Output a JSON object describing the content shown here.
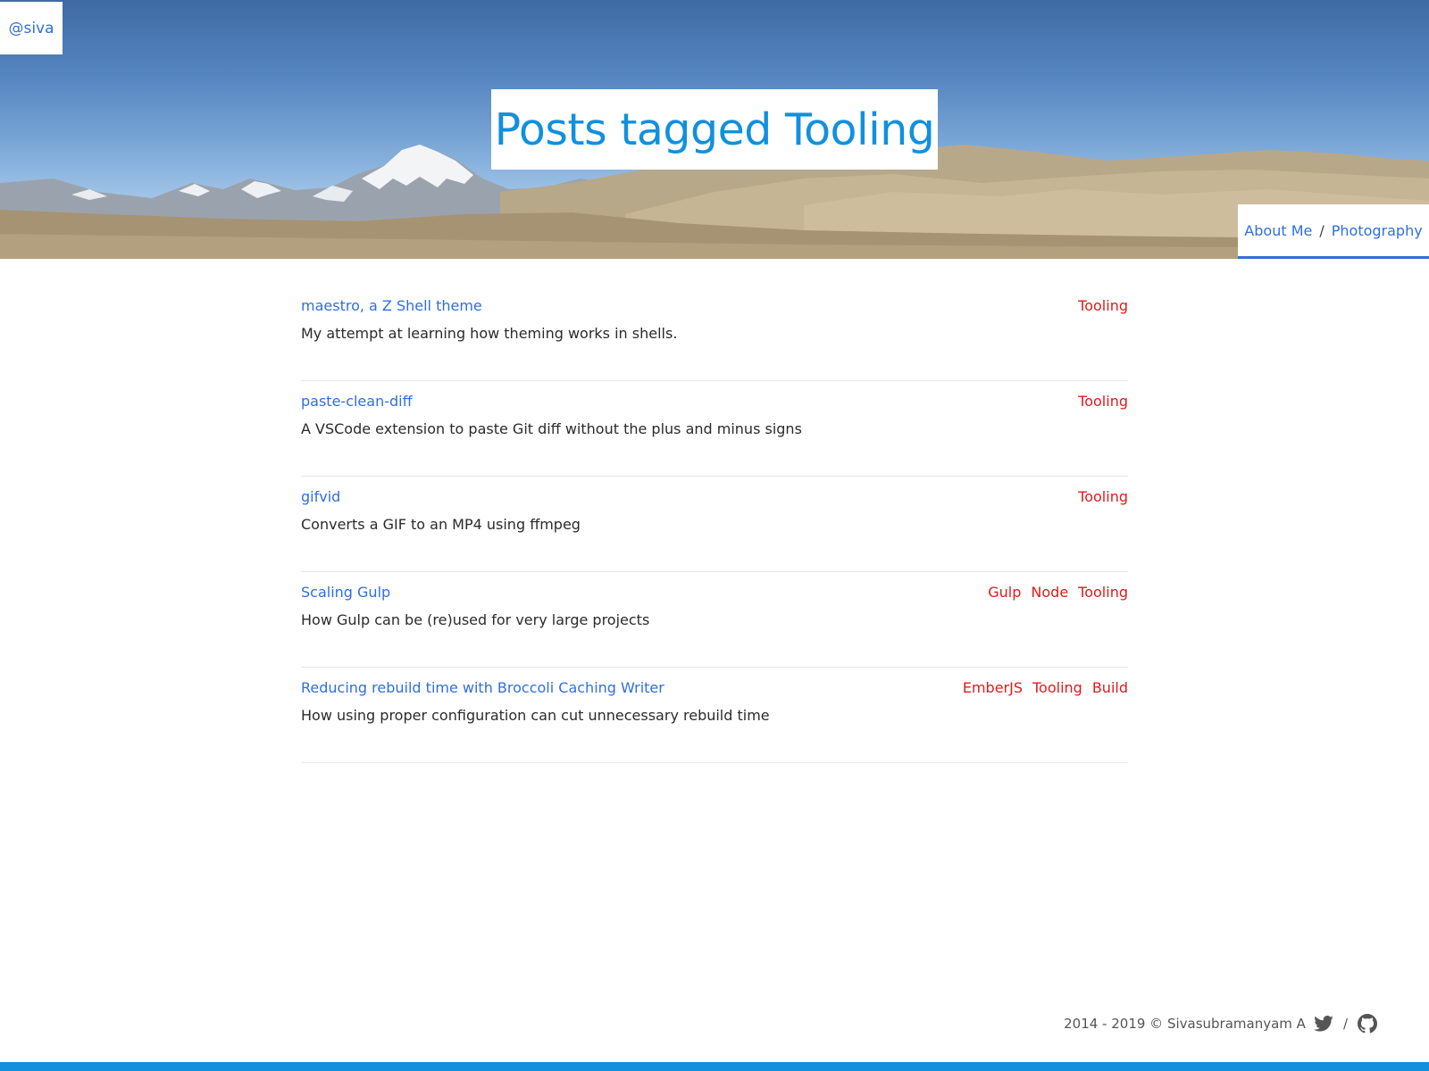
{
  "header": {
    "handle": "@siva",
    "title": "Posts tagged Tooling",
    "nav": [
      {
        "label": "About Me"
      },
      {
        "label": "Photography"
      }
    ],
    "nav_separator": "/"
  },
  "posts": [
    {
      "title": "maestro, a Z Shell theme",
      "description": "My attempt at learning how theming works in shells.",
      "tags": [
        "Tooling"
      ]
    },
    {
      "title": "paste-clean-diff",
      "description": "A VSCode extension to paste Git diff without the plus and minus signs",
      "tags": [
        "Tooling"
      ]
    },
    {
      "title": "gifvid",
      "description": "Converts a GIF to an MP4 using ffmpeg",
      "tags": [
        "Tooling"
      ]
    },
    {
      "title": "Scaling Gulp",
      "description": "How Gulp can be (re)used for very large projects",
      "tags": [
        "Gulp",
        "Node",
        "Tooling"
      ]
    },
    {
      "title": "Reducing rebuild time with Broccoli Caching Writer",
      "description": "How using proper configuration can cut unnecessary rebuild time",
      "tags": [
        "EmberJS",
        "Tooling",
        "Build"
      ]
    }
  ],
  "footer": {
    "copyright": "2014 - 2019 © Sivasubramanyam A",
    "separator": "/",
    "icons": [
      "twitter-icon",
      "github-icon"
    ]
  },
  "colors": {
    "link": "#2f6fe0",
    "title": "#1190de",
    "tag": "#e01b1b",
    "bottom_bar": "#1190de"
  }
}
